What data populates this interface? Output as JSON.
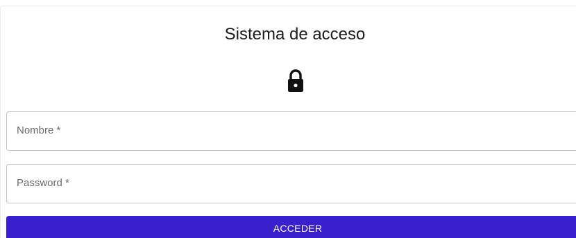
{
  "login": {
    "title": "Sistema de acceso",
    "icon": "lock-icon",
    "fields": [
      {
        "label": "Nombre *",
        "value": ""
      },
      {
        "label": "Password *",
        "value": ""
      }
    ],
    "submit_label": "ACCEDER",
    "colors": {
      "button": "#3a1fcf",
      "button_text": "#ffffff",
      "field_border": "#c4c4c4",
      "label": "#6b6b6b"
    }
  }
}
